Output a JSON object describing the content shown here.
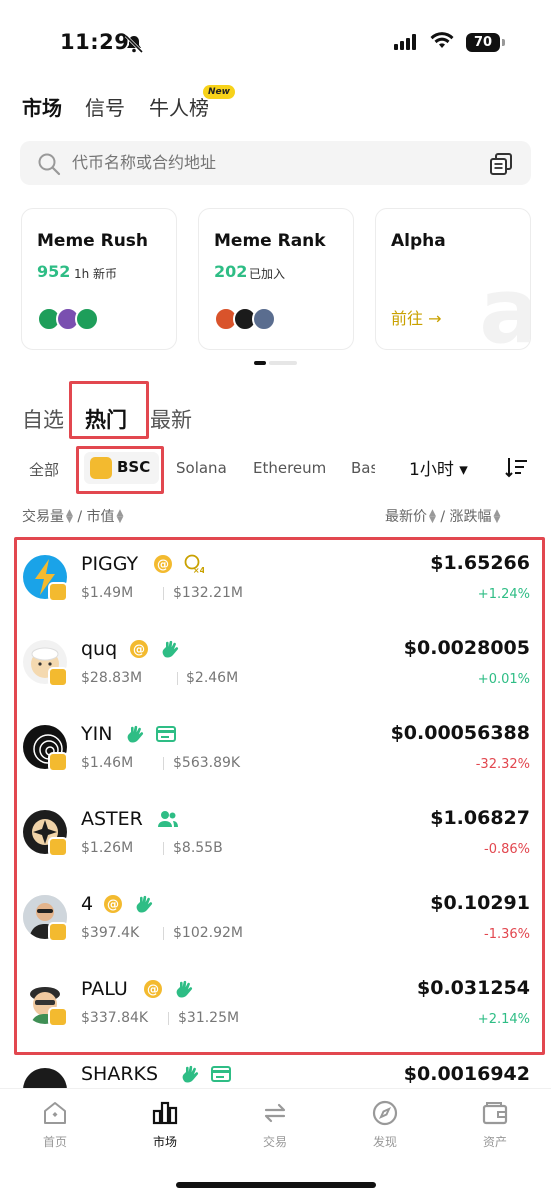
{
  "status_bar": {
    "time": "11:29",
    "battery": "70"
  },
  "top_tabs": [
    {
      "label": "市场",
      "active": true
    },
    {
      "label": "信号",
      "active": false
    },
    {
      "label": "牛人榜",
      "active": false,
      "badge": "New"
    }
  ],
  "search": {
    "placeholder": "代币名称或合约地址"
  },
  "cards": [
    {
      "title": "Meme Rush",
      "count": "952",
      "sub": "1h 新币"
    },
    {
      "title": "Meme Rank",
      "count": "202",
      "sub": "已加入"
    },
    {
      "title": "Alpha",
      "action": "前往 →"
    }
  ],
  "section_tabs": [
    {
      "label": "自选",
      "active": false
    },
    {
      "label": "热门",
      "active": true
    },
    {
      "label": "最新",
      "active": false
    }
  ],
  "chains": {
    "all": "全部",
    "active": "BSC",
    "others": [
      "Solana",
      "Ethereum",
      "Bas"
    ]
  },
  "time_filter": "1小时 ▾",
  "columns": {
    "left": "交易量 ⬍ / 市值",
    "left_a": "交易量",
    "left_b": "/ 市值",
    "right_a": "最新价",
    "right_b": "/ 涨跌幅"
  },
  "tokens": [
    {
      "name": "PIGGY",
      "volume": "$1.49M",
      "mcap": "$132.21M",
      "price": "$1.65266",
      "change": "+1.24%",
      "dir": "up"
    },
    {
      "name": "quq",
      "volume": "$28.83M",
      "mcap": "$2.46M",
      "price": "$0.0028005",
      "change": "+0.01%",
      "dir": "up"
    },
    {
      "name": "YIN",
      "volume": "$1.46M",
      "mcap": "$563.89K",
      "price": "$0.00056388",
      "change": "-32.32%",
      "dir": "down"
    },
    {
      "name": "ASTER",
      "volume": "$1.26M",
      "mcap": "$8.55B",
      "price": "$1.06827",
      "change": "-0.86%",
      "dir": "down"
    },
    {
      "name": "4",
      "volume": "$397.4K",
      "mcap": "$102.92M",
      "price": "$0.10291",
      "change": "-1.36%",
      "dir": "down"
    },
    {
      "name": "PALU",
      "volume": "$337.84K",
      "mcap": "$31.25M",
      "price": "$0.031254",
      "change": "+2.14%",
      "dir": "up"
    }
  ],
  "partial_token": {
    "name": "SHARKS",
    "price": "$0.0016942"
  },
  "bottom_nav": [
    {
      "label": "首页",
      "active": false
    },
    {
      "label": "市场",
      "active": true
    },
    {
      "label": "交易",
      "active": false
    },
    {
      "label": "发现",
      "active": false
    },
    {
      "label": "资产",
      "active": false
    }
  ],
  "colors": {
    "up": "#2ebd85",
    "down": "#e2474f",
    "highlight_box": "#e2474f",
    "bnb": "#f3ba2f"
  }
}
